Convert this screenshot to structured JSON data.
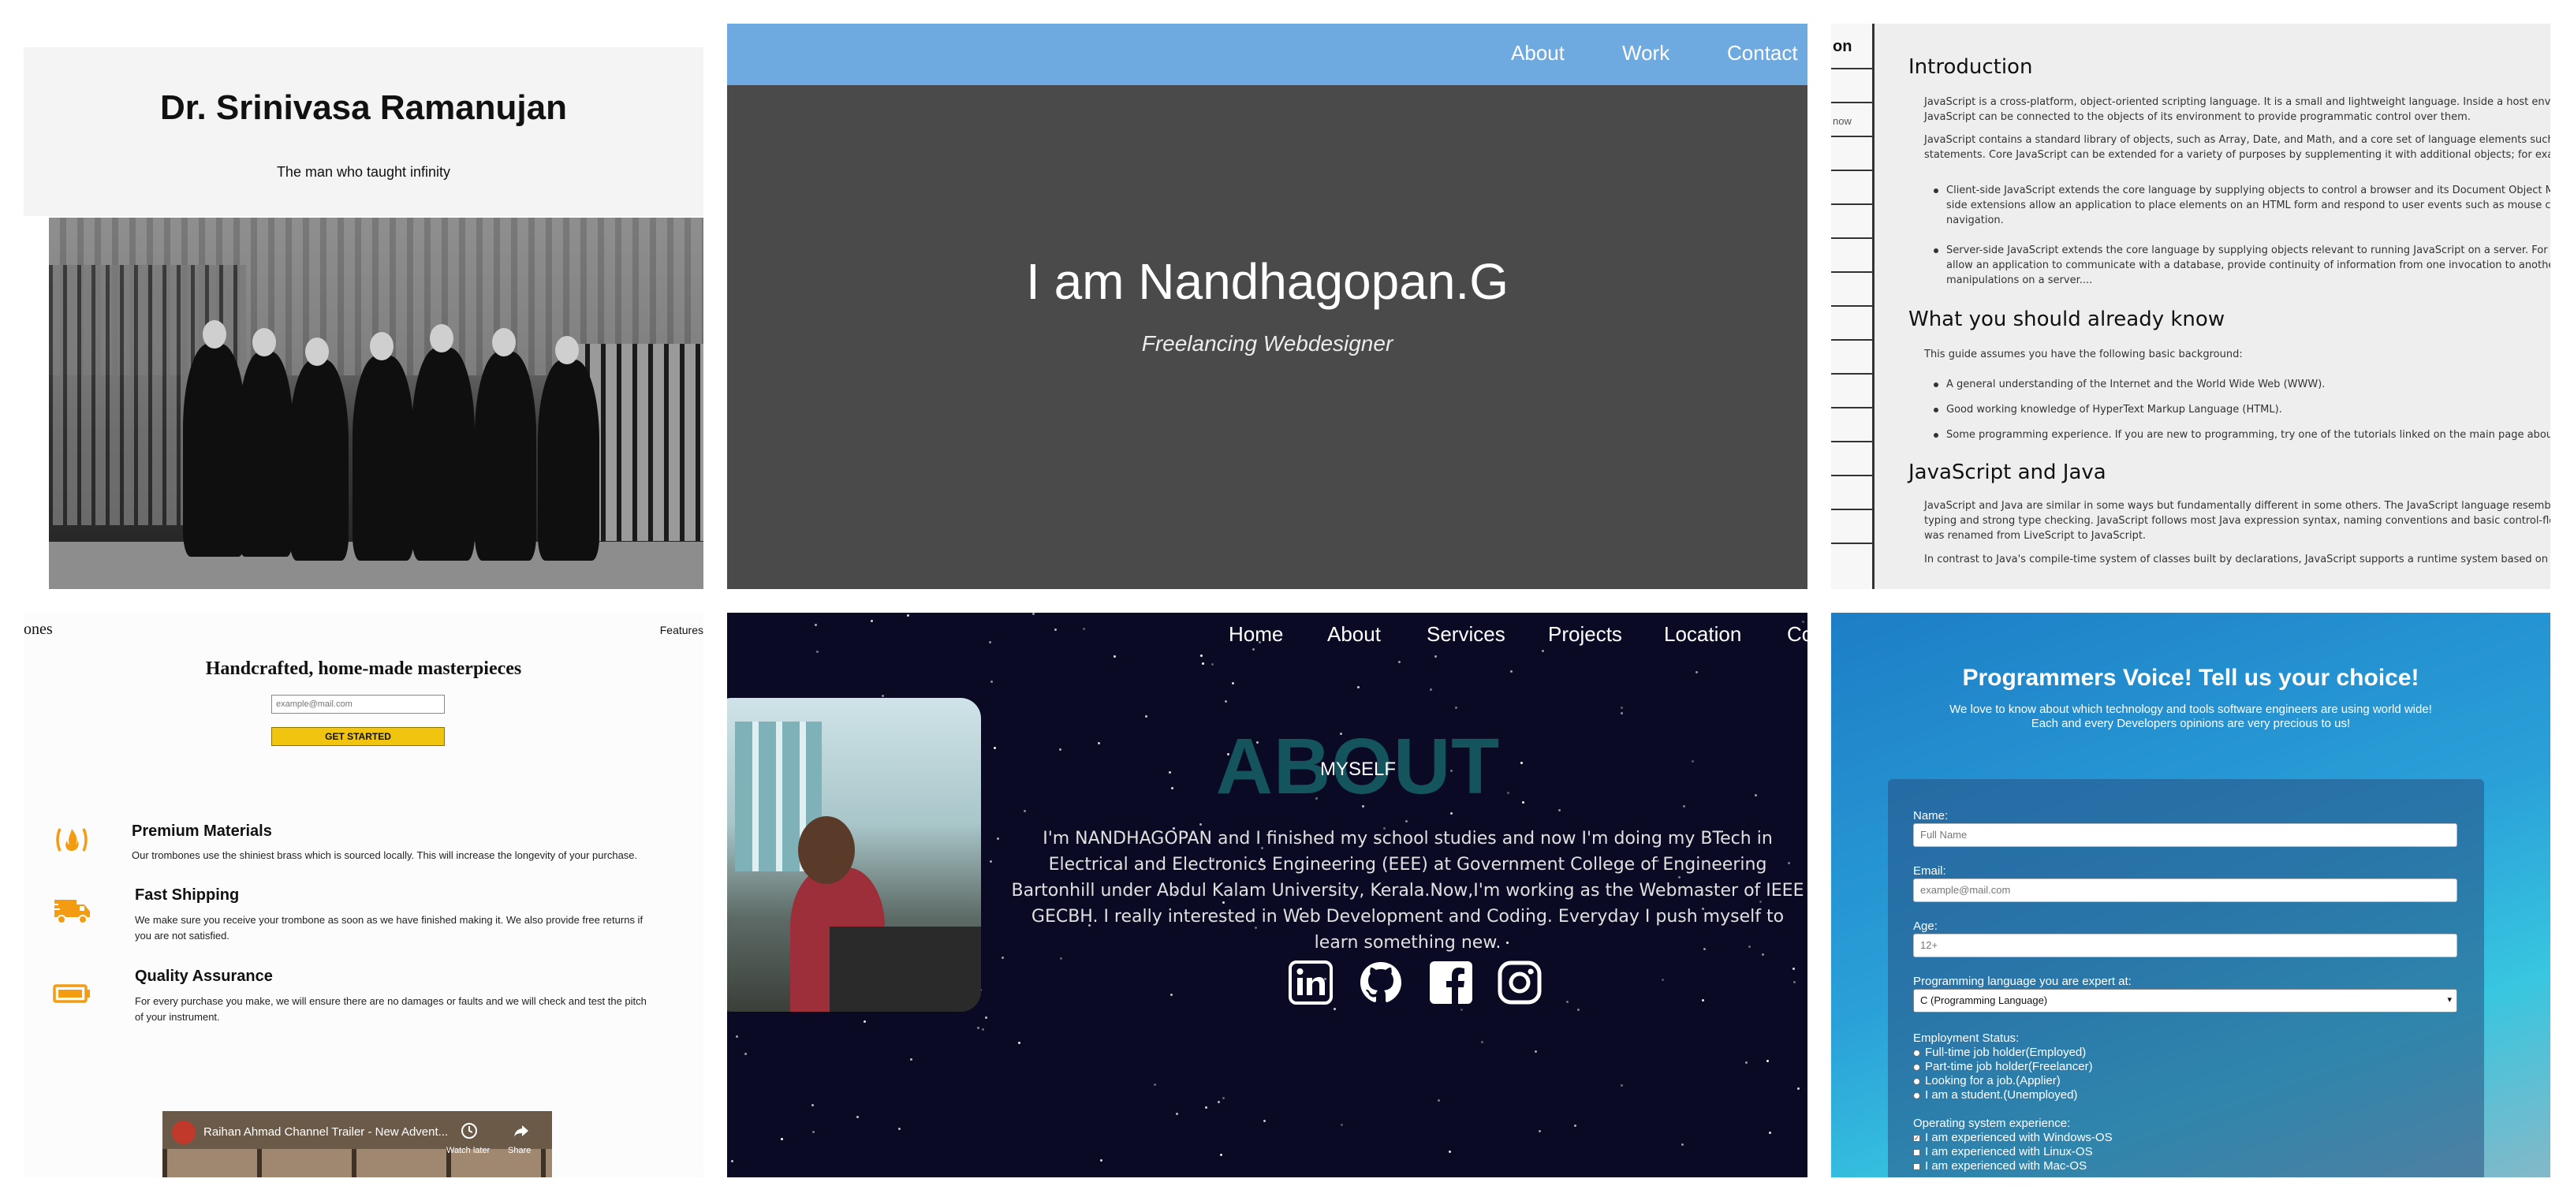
{
  "panel1": {
    "title": "Dr. Srinivasa Ramanujan",
    "subtitle": "The man who taught infinity"
  },
  "panel2": {
    "nav": [
      "About",
      "Work",
      "Contact"
    ],
    "headline": "I am Nandhagopan.G",
    "tagline": "Freelancing Webdesigner",
    "nav_color": "#6ea9e0"
  },
  "panel3": {
    "sidebar_title": "on",
    "sidebar_item": "now",
    "sections": [
      {
        "heading": "Introduction",
        "paragraphs": [
          [
            "JavaScript is a cross-platform, object-oriented scripting language. It is a small and lightweight language. Inside a host environment (for e",
            "JavaScript can be connected to the objects of its environment to provide programmatic control over them."
          ],
          [
            "JavaScript contains a standard library of objects, such as Array, Date, and Math, and a core set of language elements such as operators, c",
            "statements. Core JavaScript can be extended for a variety of purposes by supplementing it with additional objects; for example:"
          ]
        ],
        "bullets": [
          [
            "Client-side JavaScript extends the core language by supplying objects to control a browser and its Document Object Model (DO",
            "side extensions allow an application to place elements on an HTML form and respond to user events such as mouse clicks, form",
            "navigation."
          ],
          [
            "Server-side JavaScript extends the core language by supplying objects relevant to running JavaScript on a server. For example, s",
            "allow an application to communicate with a database, provide continuity of information from one invocation to another of the a",
            "manipulations on a server...."
          ]
        ]
      },
      {
        "heading": "What you should already know",
        "intro": "This guide assumes you have the following basic background:",
        "bullets": [
          "A general understanding of the Internet and the World Wide Web (WWW).",
          "Good working knowledge of HyperText Markup Language (HTML).",
          "Some programming experience. If you are new to programming, try one of the tutorials linked on the main page about JavaScri"
        ]
      },
      {
        "heading": "JavaScript and Java",
        "paragraphs": [
          [
            "JavaScript and Java are similar in some ways but fundamentally different in some others. The JavaScript language resembles Java but do",
            "typing and strong type checking. JavaScript follows most Java expression syntax, naming conventions and basic control-flow constructs w",
            "was renamed from LiveScript to JavaScript."
          ],
          [
            "In contrast to Java's compile-time system of classes built by declarations, JavaScript supports a runtime system based on a small numbe"
          ]
        ]
      }
    ]
  },
  "panel4": {
    "brand": "ones",
    "nav_features": "Features",
    "heading": "Handcrafted, home-made masterpieces",
    "email_placeholder": "example@mail.com",
    "cta": "GET STARTED",
    "features": [
      {
        "icon": "fire-icon",
        "title": "Premium Materials",
        "desc": "Our trombones use the shiniest brass which is sourced locally. This will increase the longevity of your purchase."
      },
      {
        "icon": "truck-icon",
        "title": "Fast Shipping",
        "desc": "We make sure you receive your trombone as soon as we have finished making it. We also provide free returns if you are not satisfied."
      },
      {
        "icon": "battery-icon",
        "title": "Quality Assurance",
        "desc": "For every purchase you make, we will ensure there are no damages or faults and we will check and test the pitch of your instrument."
      }
    ],
    "video_title": "Raihan Ahmad Channel Trailer - New Advent...",
    "video_watch_later": "Watch later",
    "video_share": "Share",
    "accent": "#f39c12"
  },
  "panel5": {
    "nav": [
      "Home",
      "About",
      "Services",
      "Projects",
      "Location",
      "Co"
    ],
    "big_heading": "ABOUT",
    "overlay": "MYSELF",
    "paragraph": "I'm NANDHAGOPAN and I finished my school studies and now I'm doing my BTech in Electrical and Electronics Engineering (EEE) at Government College of Engineering Bartonhill under Abdul Kalam University, Kerala.Now,I'm working as the Webmaster of IEEE GECBH. I really interested in Web Development and Coding. Everyday I push myself to learn something new.",
    "social": [
      "linkedin-icon",
      "github-icon",
      "facebook-icon",
      "instagram-icon"
    ]
  },
  "panel6": {
    "title": "Programmers Voice! Tell us your choice!",
    "description": "We love to know about which technology and tools software engineers are using world wide! Each and every Developers opinions are very precious to us!",
    "fields": [
      {
        "label": "Name:",
        "placeholder": "Full Name"
      },
      {
        "label": "Email:",
        "placeholder": "example@mail.com"
      },
      {
        "label": "Age:",
        "placeholder": "12+"
      }
    ],
    "language_label": "Programming language you are expert at:",
    "language_value": "C (Programming Language)",
    "employment_label": "Employment Status:",
    "employment_options": [
      "Full-time job holder(Employed)",
      "Part-time job holder(Freelancer)",
      "Looking for a job.(Applier)",
      "I am a student.(Unemployed)"
    ],
    "os_label": "Operating system experience:",
    "os_options": [
      "I am experienced with Windows-OS",
      "I am experienced with Linux-OS",
      "I am experienced with Mac-OS"
    ]
  }
}
